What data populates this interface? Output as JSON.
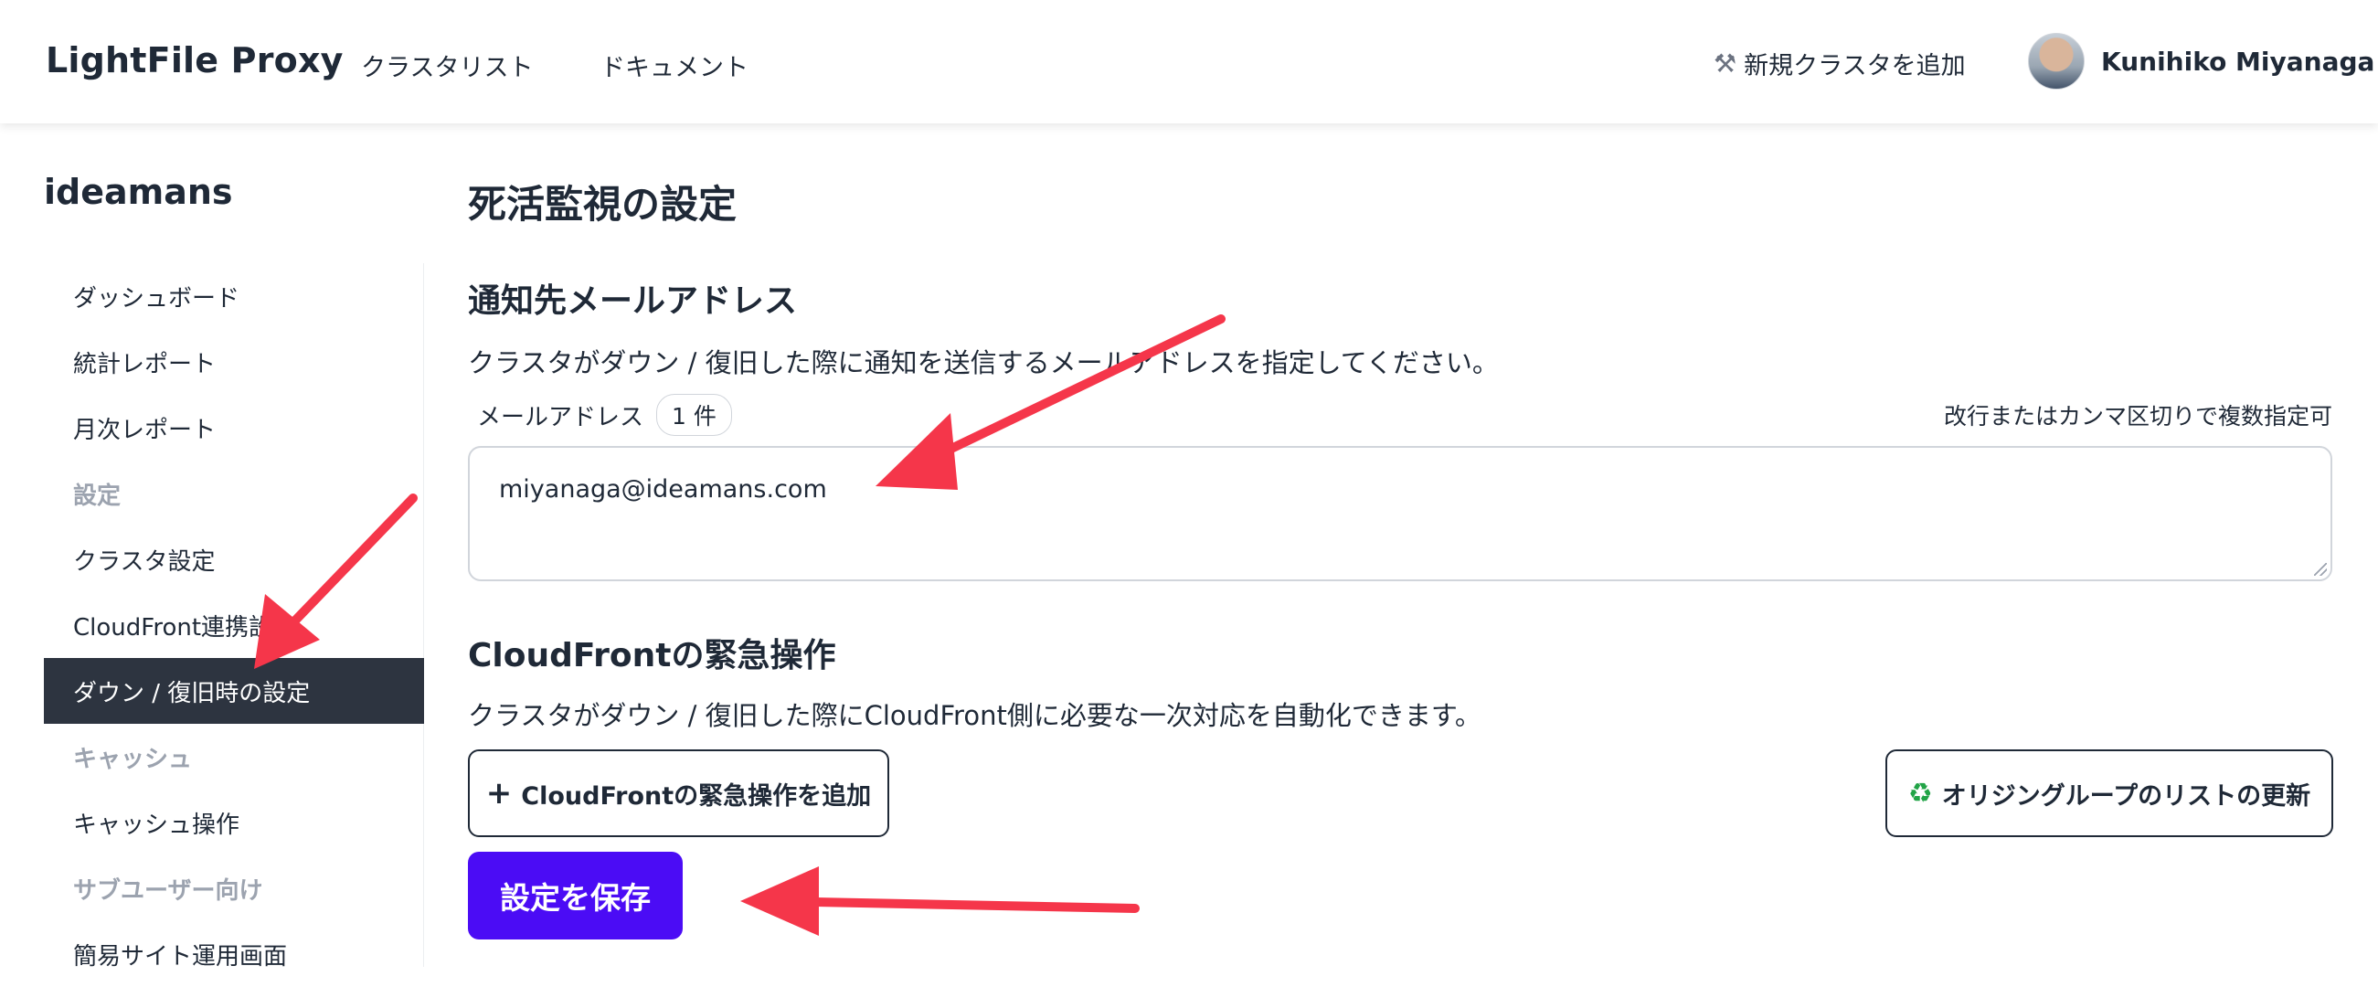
{
  "header": {
    "brand": "LightFile Proxy",
    "nav": [
      "クラスタリスト",
      "ドキュメント"
    ],
    "add_cluster_label": "新規クラスタを追加",
    "add_cluster_icon": "tools-icon",
    "user_name": "Kunihiko Miyanaga"
  },
  "sidebar": {
    "org_name": "ideamans",
    "items": [
      {
        "label": "ダッシュボード",
        "type": "link"
      },
      {
        "label": "統計レポート",
        "type": "link"
      },
      {
        "label": "月次レポート",
        "type": "link"
      },
      {
        "label": "設定",
        "type": "section"
      },
      {
        "label": "クラスタ設定",
        "type": "link"
      },
      {
        "label": "CloudFront連携設定",
        "type": "link"
      },
      {
        "label": "ダウン / 復旧時の設定",
        "type": "active"
      },
      {
        "label": "キャッシュ",
        "type": "section"
      },
      {
        "label": "キャッシュ操作",
        "type": "link"
      },
      {
        "label": "サブユーザー向け",
        "type": "section"
      },
      {
        "label": "簡易サイト運用画面",
        "type": "link"
      }
    ]
  },
  "main": {
    "title": "死活監視の設定",
    "email_section": {
      "title": "通知先メールアドレス",
      "description": "クラスタがダウン / 復旧した際に通知を送信するメールアドレスを指定してください。",
      "field_label": "メールアドレス",
      "count": "1 件",
      "hint": "改行またはカンマ区切りで複数指定可",
      "value": "miyanaga@ideamans.com"
    },
    "cloudfront_section": {
      "title": "CloudFrontの緊急操作",
      "description": "クラスタがダウン / 復旧した際にCloudFront側に必要な一次対応を自動化できます。",
      "add_button": "CloudFrontの緊急操作を追加",
      "refresh_button": "オリジングループのリストの更新"
    },
    "save_button": "設定を保存"
  },
  "colors": {
    "primary_button": "#4b0cf5",
    "sidebar_active": "#2d3440",
    "annotation_arrow": "#f5364a"
  }
}
